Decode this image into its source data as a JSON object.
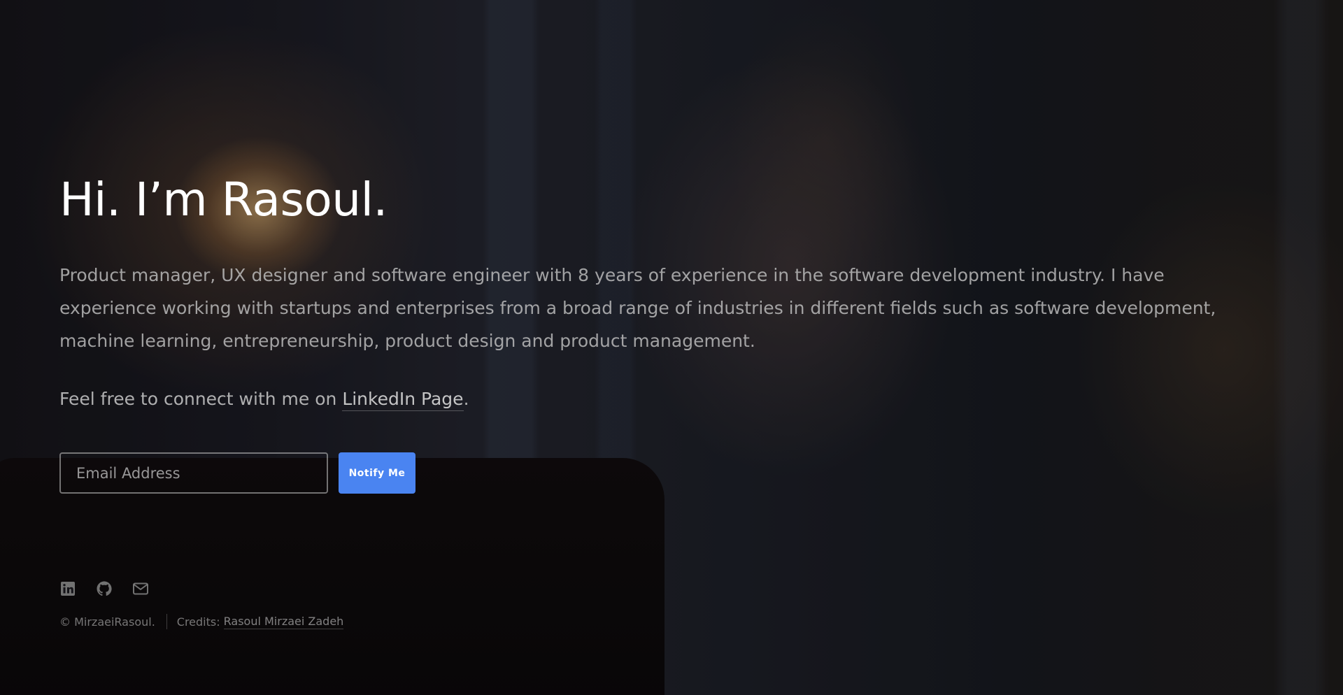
{
  "hero": {
    "title": "Hi. I’m Rasoul.",
    "intro": "Product manager, UX designer and software engineer with 8 years of experience in the software development industry. I have experience working with startups and enterprises from a broad range of industries in different fields such as software development, machine learning, entrepreneurship, product design and product management.",
    "connect_prefix": "Feel free to connect with me on ",
    "connect_link": "LinkedIn Page",
    "connect_suffix": "."
  },
  "form": {
    "email_placeholder": "Email Address",
    "button_label": "Notify Me",
    "button_color": "#4a84f1"
  },
  "socials": [
    {
      "icon": "linkedin-icon"
    },
    {
      "icon": "github-icon"
    },
    {
      "icon": "envelope-icon"
    }
  ],
  "footer": {
    "copyright": "© MirzaeiRasoul.",
    "credits_label": "Credits:",
    "credits_link": "Rasoul Mirzaei Zadeh"
  }
}
